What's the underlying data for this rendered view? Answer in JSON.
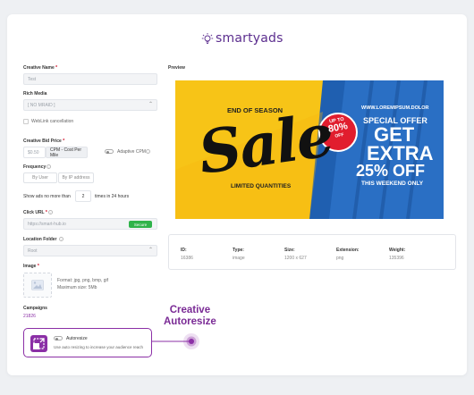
{
  "brand": {
    "name": "smartyads"
  },
  "form": {
    "creative_name": {
      "label": "Creative Name",
      "value": "Test"
    },
    "rich_media": {
      "label": "Rich Media",
      "value": "[ NO MRAID ]"
    },
    "weblink_cancellation": "WebLink cancellation",
    "bid_price": {
      "label": "Creative Bid Price",
      "value": "$0.50",
      "unit": "CPM - Cost Per Mile",
      "adaptive": "Adaptive CPM"
    },
    "frequency": {
      "label": "Frequency",
      "by_user": "By User",
      "by_ip": "By IP address"
    },
    "show_ads": {
      "prefix": "Show ads no more than",
      "value": "2",
      "suffix": "times in 24 hours"
    },
    "click_url": {
      "label": "Click URL",
      "value": "https://smart-hub.io",
      "badge": "Secure"
    },
    "location_folder": {
      "label": "Location Folder",
      "value": "Root"
    },
    "image": {
      "label": "Image",
      "format": "Format: jpg, png, bmp, gif",
      "max_size": "Maximum size: 5Mb"
    },
    "campaigns": {
      "label": "Campaigns",
      "value": "21826"
    },
    "autoresize": {
      "title": "Autoresize",
      "desc": "Use auto resizing to increase your audience reach"
    }
  },
  "preview": {
    "label": "Preview",
    "end_of_season": "END OF SEASON",
    "sale": "Sale",
    "limited": "LIMITED QUANTITIES",
    "badge_up": "UP TO",
    "badge_pct": "80%",
    "badge_off": "OFF",
    "website": "WWW.LOREMIPSUM.DOLOR",
    "special": "SPECIAL OFFER",
    "get": "GET",
    "extra": "EXTRA",
    "pct_off": "25% OFF",
    "weekend": "THIS WEEKEND ONLY"
  },
  "details": {
    "id": {
      "k": "ID:",
      "v": "16386"
    },
    "type": {
      "k": "Type:",
      "v": "image"
    },
    "size": {
      "k": "Size:",
      "v": "1200 x 627"
    },
    "extension": {
      "k": "Extension:",
      "v": "png"
    },
    "weight": {
      "k": "Weight:",
      "v": "135396"
    }
  },
  "callout": {
    "line1": "Creative",
    "line2": "Autoresize"
  },
  "colors": {
    "brand": "#5b2d8e",
    "accent": "#8b2fa6",
    "secure": "#2fb34a",
    "sale_red": "#e11d2e",
    "sale_blue": "#1f5fb0",
    "sale_yellow": "#f7c417"
  }
}
